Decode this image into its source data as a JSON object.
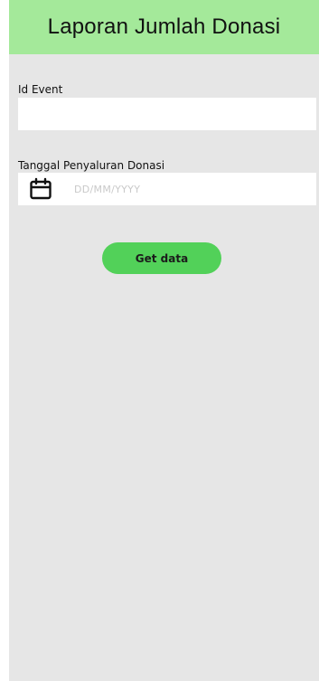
{
  "header": {
    "title": "Laporan Jumlah Donasi"
  },
  "form": {
    "event_id": {
      "label": "Id Event",
      "value": "",
      "placeholder": ""
    },
    "distribution_date": {
      "label": "Tanggal Penyaluran Donasi",
      "value": "",
      "placeholder": "DD/MM/YYYY",
      "icon": "calendar-icon"
    },
    "submit_label": "Get data"
  },
  "colors": {
    "header_bg": "#a4e99a",
    "screen_bg": "#e6e6e6",
    "button_bg": "#52d159"
  }
}
